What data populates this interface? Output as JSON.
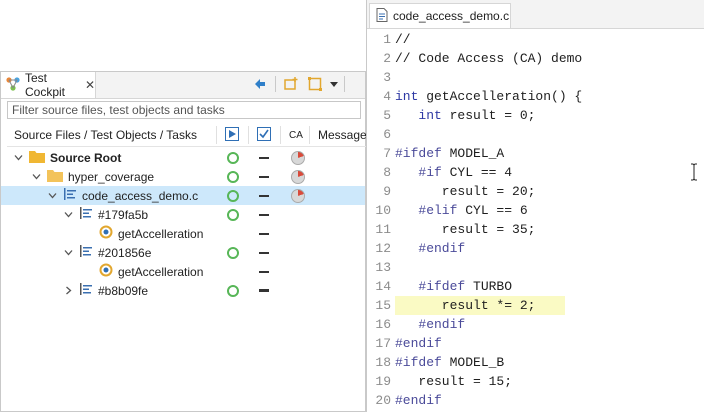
{
  "cockpit": {
    "tab_label": "Test Cockpit",
    "filter_placeholder": "Filter source files, test objects and tasks",
    "columns": {
      "name": "Source Files / Test Objects / Tasks",
      "ca": "CA",
      "messages": "Message"
    },
    "tree": [
      {
        "label": "Source Root",
        "expanded": true,
        "icon": "folder-icon"
      },
      {
        "label": "hyper_coverage",
        "expanded": true,
        "icon": "folder-icon"
      },
      {
        "label": "code_access_demo.c",
        "expanded": true,
        "icon": "source-file-icon",
        "selected": true
      },
      {
        "label": "#179fa5b",
        "expanded": true,
        "icon": "test-object-icon"
      },
      {
        "label": "getAccelleration",
        "icon": "function-icon"
      },
      {
        "label": "#201856e",
        "expanded": true,
        "icon": "test-object-icon"
      },
      {
        "label": "getAccelleration",
        "icon": "function-icon"
      },
      {
        "label": "#b8b09fe",
        "expanded": false,
        "icon": "test-object-icon"
      }
    ]
  },
  "editor": {
    "tab_label": "code_access_demo.c",
    "highlight_line": 15,
    "lines": [
      {
        "n": "1",
        "text": "//"
      },
      {
        "n": "2",
        "text": "// Code Access (CA) demo"
      },
      {
        "n": "3",
        "text": ""
      },
      {
        "n": "4",
        "text": "int getAccelleration() {"
      },
      {
        "n": "5",
        "text": "   int result = 0;"
      },
      {
        "n": "6",
        "text": ""
      },
      {
        "n": "7",
        "text": "#ifdef MODEL_A"
      },
      {
        "n": "8",
        "text": "   #if CYL == 4"
      },
      {
        "n": "9",
        "text": "      result = 20;"
      },
      {
        "n": "10",
        "text": "   #elif CYL == 6"
      },
      {
        "n": "11",
        "text": "      result = 35;"
      },
      {
        "n": "12",
        "text": "   #endif"
      },
      {
        "n": "13",
        "text": ""
      },
      {
        "n": "14",
        "text": "   #ifdef TURBO"
      },
      {
        "n": "15",
        "text": "      result *= 2;"
      },
      {
        "n": "16",
        "text": "   #endif"
      },
      {
        "n": "17",
        "text": "#endif"
      },
      {
        "n": "18",
        "text": "#ifdef MODEL_B"
      },
      {
        "n": "19",
        "text": "   result = 15;"
      },
      {
        "n": "20",
        "text": "#endif"
      }
    ]
  },
  "colors": {
    "selection": "#cde8fb",
    "comment": "#3f7f5f",
    "keyword": "#2e39a4",
    "preprocessor": "#4a4a99",
    "line_highlight": "#fafac4",
    "status_green": "#57b657",
    "ca_red": "#d94a3a"
  }
}
